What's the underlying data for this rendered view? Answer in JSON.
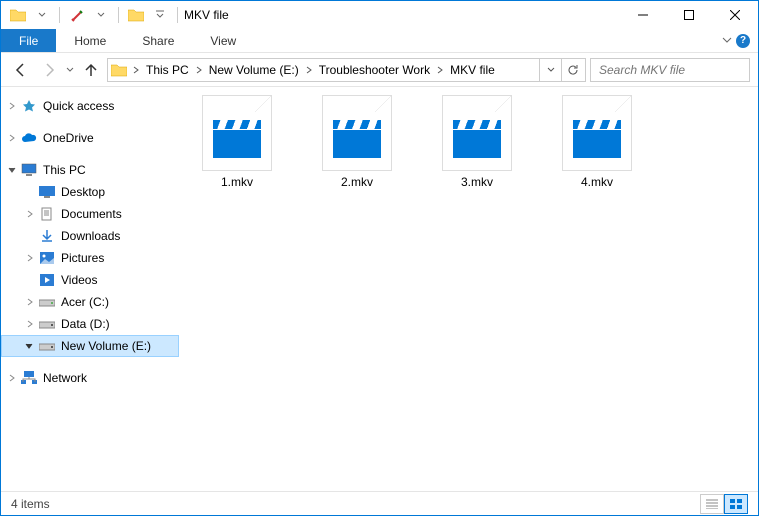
{
  "window": {
    "title": "MKV file"
  },
  "ribbon": {
    "file": "File",
    "tabs": [
      "Home",
      "Share",
      "View"
    ]
  },
  "breadcrumbs": [
    "This PC",
    "New Volume (E:)",
    "Troubleshooter Work",
    "MKV file"
  ],
  "search": {
    "placeholder": "Search MKV file"
  },
  "sidebar": {
    "top": [
      {
        "label": "Quick access",
        "icon": "star"
      },
      {
        "label": "OneDrive",
        "icon": "cloud"
      }
    ],
    "thispc": {
      "label": "This PC",
      "icon": "pc"
    },
    "thispc_children": [
      {
        "label": "Desktop",
        "icon": "desktop"
      },
      {
        "label": "Documents",
        "icon": "docs"
      },
      {
        "label": "Downloads",
        "icon": "down"
      },
      {
        "label": "Pictures",
        "icon": "pics"
      },
      {
        "label": "Videos",
        "icon": "vids"
      },
      {
        "label": "Acer (C:)",
        "icon": "drive"
      },
      {
        "label": "Data (D:)",
        "icon": "drive"
      },
      {
        "label": "New Volume (E:)",
        "icon": "drive",
        "selected": true
      }
    ],
    "network": {
      "label": "Network",
      "icon": "net"
    }
  },
  "files": [
    {
      "name": "1.mkv"
    },
    {
      "name": "2.mkv"
    },
    {
      "name": "3.mkv"
    },
    {
      "name": "4.mkv"
    }
  ],
  "status": {
    "count": "4 items"
  }
}
